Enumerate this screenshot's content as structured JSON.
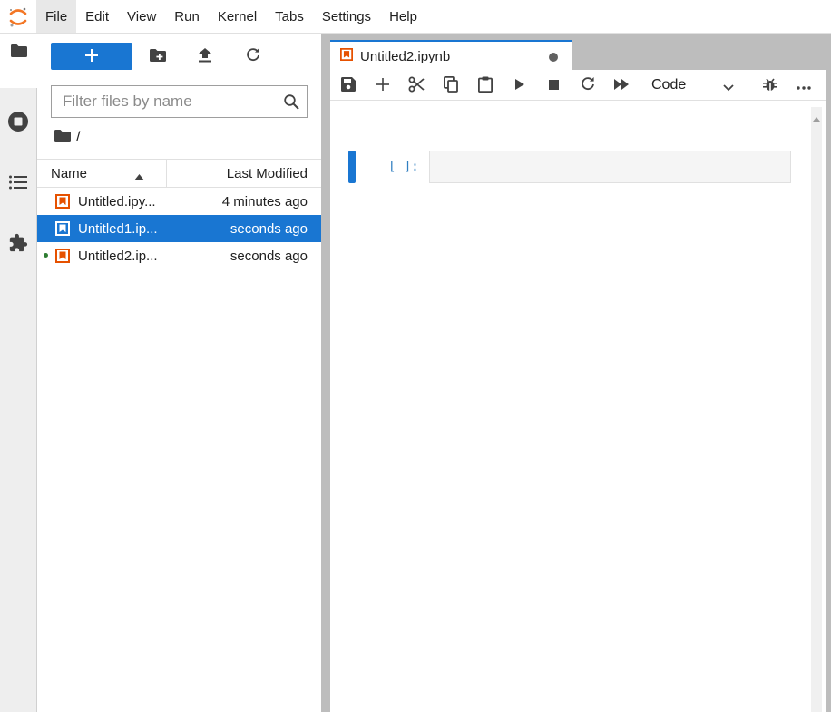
{
  "menubar": {
    "logo": "jupyter-logo-icon",
    "items": [
      {
        "label": "File"
      },
      {
        "label": "Edit"
      },
      {
        "label": "View"
      },
      {
        "label": "Run"
      },
      {
        "label": "Kernel"
      },
      {
        "label": "Tabs"
      },
      {
        "label": "Settings"
      },
      {
        "label": "Help"
      }
    ],
    "active_item": "File"
  },
  "activity_bar": {
    "items": [
      {
        "icon": "folder-icon",
        "label": "File Browser"
      },
      {
        "icon": "running-sessions-icon",
        "label": "Running Terminals and Kernels"
      },
      {
        "icon": "table-of-contents-icon",
        "label": "Table of Contents"
      },
      {
        "icon": "extension-manager-icon",
        "label": "Extension Manager"
      }
    ]
  },
  "filebrowser": {
    "new_launcher": "+",
    "filter": {
      "placeholder": "Filter files by name",
      "value": ""
    },
    "breadcrumb": "/",
    "columns": {
      "name": "Name",
      "modified": "Last Modified"
    },
    "files": [
      {
        "name": "Untitled.ipy...",
        "modified": "4 minutes ago",
        "selected": false,
        "running": false
      },
      {
        "name": "Untitled1.ip...",
        "modified": "seconds ago",
        "selected": true,
        "running": false
      },
      {
        "name": "Untitled2.ip...",
        "modified": "seconds ago",
        "selected": false,
        "running": true
      }
    ]
  },
  "notebook": {
    "tab": {
      "title": "Untitled2.ipynb",
      "dirty": true
    },
    "cell_type": "Code",
    "cell": {
      "prompt": "[ ]:",
      "source": ""
    }
  },
  "colors": {
    "accent": "#1976d2",
    "notebook_icon": "#e65100",
    "running_dot": "#2e7d32",
    "prompt": "#307fc1"
  }
}
